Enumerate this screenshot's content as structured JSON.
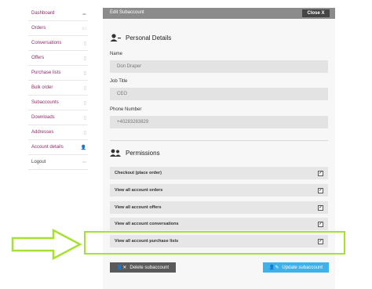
{
  "sidebar": {
    "items": [
      {
        "label": "Dashboard",
        "icon": "cloud-icon"
      },
      {
        "label": "Orders",
        "icon": "box-icon"
      },
      {
        "label": "Conversations",
        "icon": "document-icon"
      },
      {
        "label": "Offers",
        "icon": "document-icon"
      },
      {
        "label": "Purchase lists",
        "icon": "document-icon"
      },
      {
        "label": "Bulk order",
        "icon": "document-icon"
      },
      {
        "label": "Subaccounts",
        "icon": "document-icon"
      },
      {
        "label": "Downloads",
        "icon": "document-icon"
      },
      {
        "label": "Addresses",
        "icon": "document-icon"
      },
      {
        "label": "Account details",
        "icon": "user-icon"
      },
      {
        "label": "Logout",
        "icon": "logout-icon"
      }
    ]
  },
  "modal": {
    "title": "Edit Subaccount",
    "close_label": "Close X",
    "personal": {
      "title": "Personal Details",
      "name_label": "Name",
      "name_value": "Don Draper",
      "job_label": "Job Title",
      "job_value": "CEO",
      "phone_label": "Phone Number",
      "phone_value": "+40283283829"
    },
    "permissions": {
      "title": "Permissions",
      "items": [
        {
          "label": "Checkout (place order)",
          "checked": true
        },
        {
          "label": "View all account orders",
          "checked": true
        },
        {
          "label": "View all account offers",
          "checked": true
        },
        {
          "label": "View all account conversations",
          "checked": true
        },
        {
          "label": "View all account purchase lists",
          "checked": true
        }
      ]
    },
    "delete_label": "Delete subaccount",
    "update_label": "Update subaccount"
  },
  "colors": {
    "accent_link": "#8c2f6a",
    "update_button": "#3db2ea",
    "highlight": "#a6e22e"
  }
}
